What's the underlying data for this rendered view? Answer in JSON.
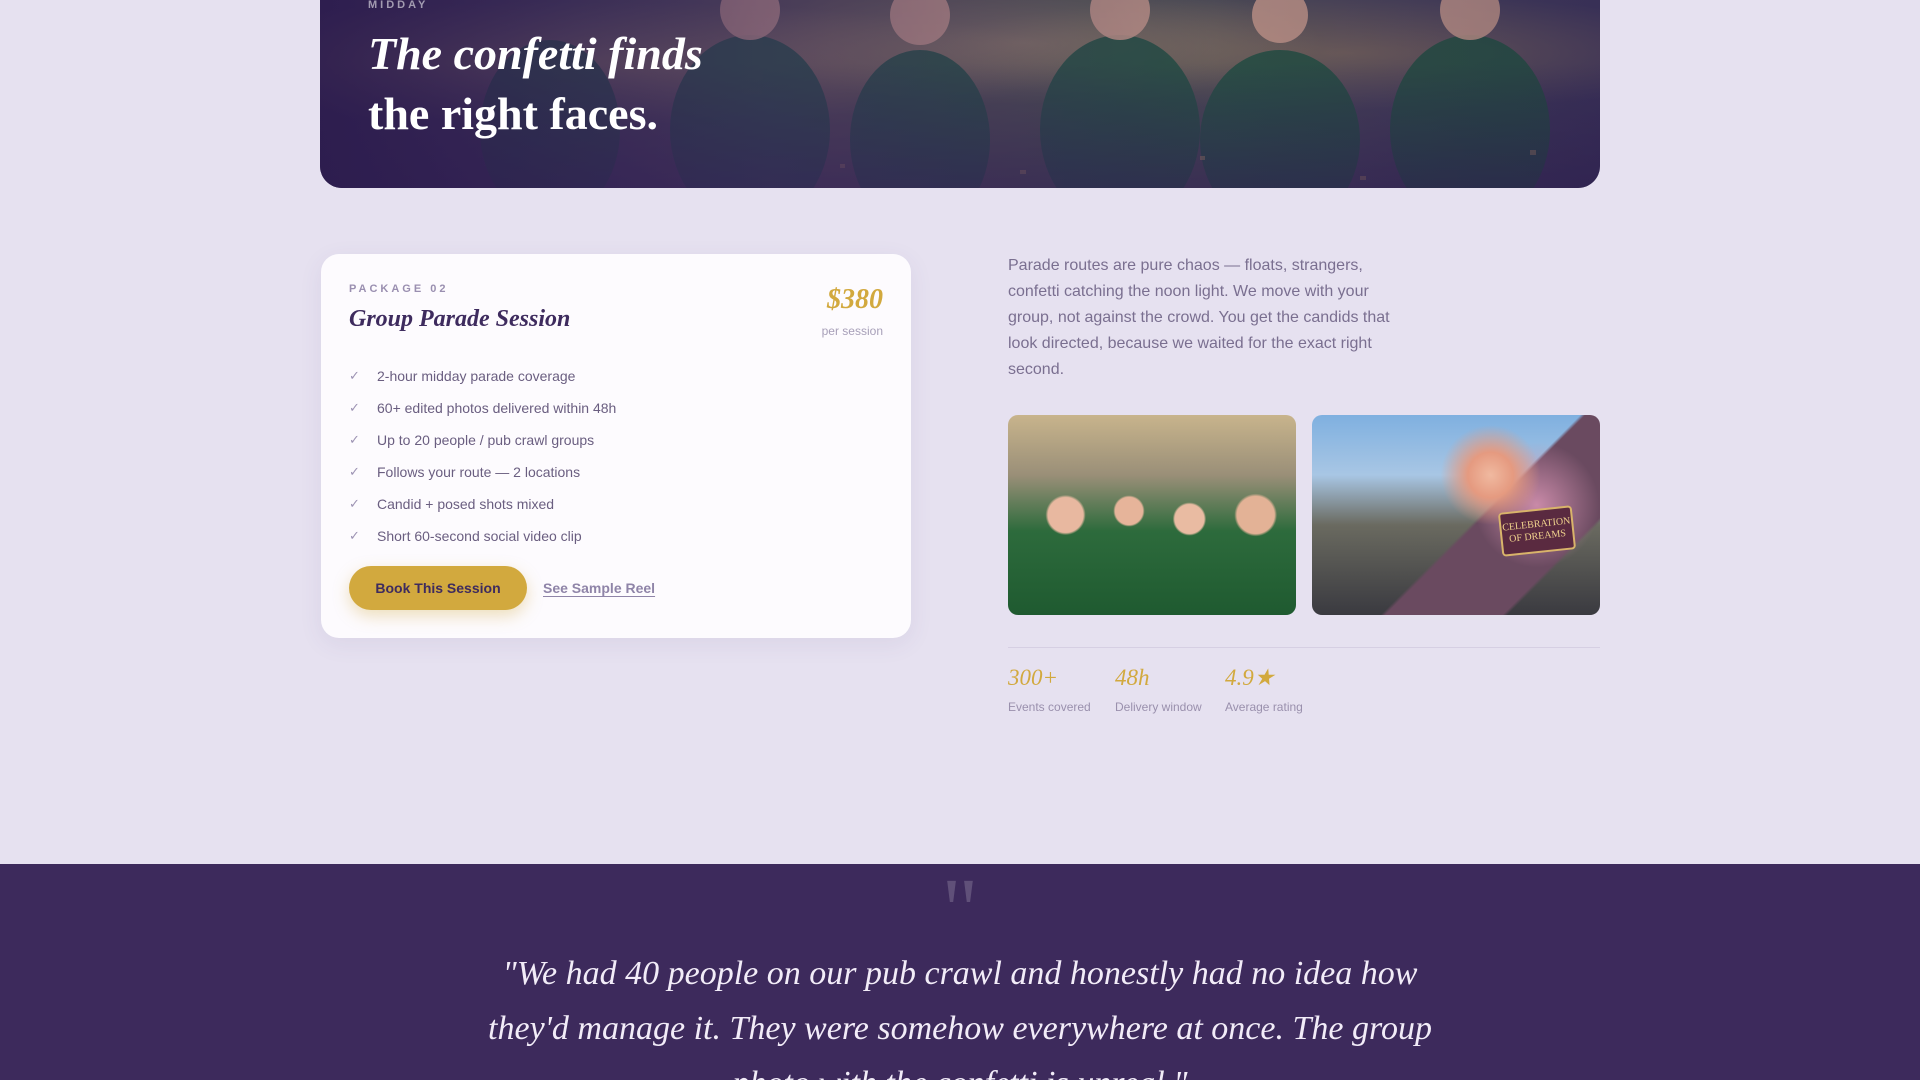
{
  "hero": {
    "eyebrow": "MIDDAY",
    "title_line1": "The confetti finds",
    "title_line2": "the right faces."
  },
  "package": {
    "label": "PACKAGE 02",
    "title": "Group Parade Session",
    "price": "$380",
    "price_unit": "per session",
    "features": [
      "2-hour midday parade coverage",
      "60+ edited photos delivered within 48h",
      "Up to 20 people / pub crawl groups",
      "Follows your route — 2 locations",
      "Candid + posed shots mixed",
      "Short 60-second social video clip"
    ],
    "check_icon": "✓",
    "book_button": "Book This Session",
    "sample_link": "See Sample Reel"
  },
  "description": "Parade routes are pure chaos — floats, strangers, confetti catching the noon light. We move with your group, not against the crowd. You get the candids that look directed, because we waited for the exact right second.",
  "photos": {
    "sign_text": "CELEBRATION OF DREAMS"
  },
  "stats": [
    {
      "value": "300+",
      "label": "Events covered"
    },
    {
      "value": "48h",
      "label": "Delivery window"
    },
    {
      "value": "4.9★",
      "label": "Average rating"
    }
  ],
  "testimonial": {
    "quote_mark": "\"",
    "text": "\"We had 40 people on our pub crawl and honestly had no idea how they'd manage it. They were somehow everywhere at once. The group photo with the confetti is unreal.\""
  },
  "colors": {
    "background": "#e6e1f0",
    "accent_gold": "#d2a93e",
    "deep_purple": "#3d2a5c",
    "card": "#fdfbfe"
  }
}
